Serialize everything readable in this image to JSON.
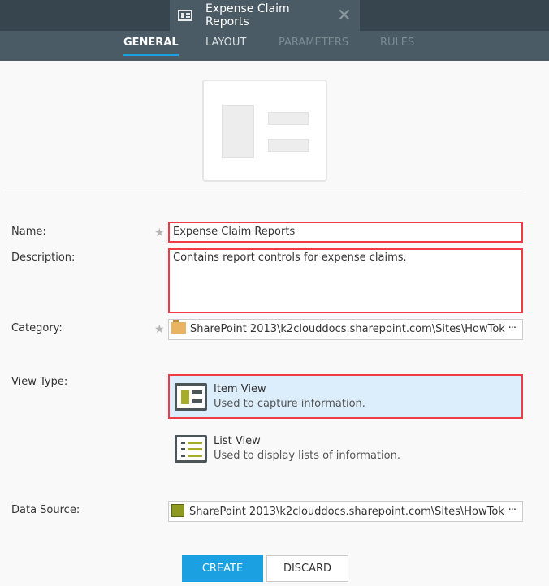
{
  "tab": {
    "title": "Expense Claim Reports",
    "close": "✕"
  },
  "nav": [
    "GENERAL",
    "LAYOUT",
    "PARAMETERS",
    "RULES"
  ],
  "form": {
    "name_label": "Name:",
    "name_value": "Expense Claim Reports",
    "description_label": "Description:",
    "description_value": "Contains report controls for expense claims.",
    "category_label": "Category:",
    "category_value": "SharePoint 2013\\k2clouddocs.sharepoint.com\\Sites\\HowTok",
    "view_type_label": "View Type:",
    "views": [
      {
        "title": "Item View",
        "desc": "Used to capture information."
      },
      {
        "title": "List View",
        "desc": "Used to display lists of information."
      }
    ],
    "data_source_label": "Data Source:",
    "data_source_value": "SharePoint 2013\\k2clouddocs.sharepoint.com\\Sites\\HowTok",
    "more": "···",
    "required": "★"
  },
  "buttons": {
    "create": "CREATE",
    "discard": "DISCARD"
  }
}
